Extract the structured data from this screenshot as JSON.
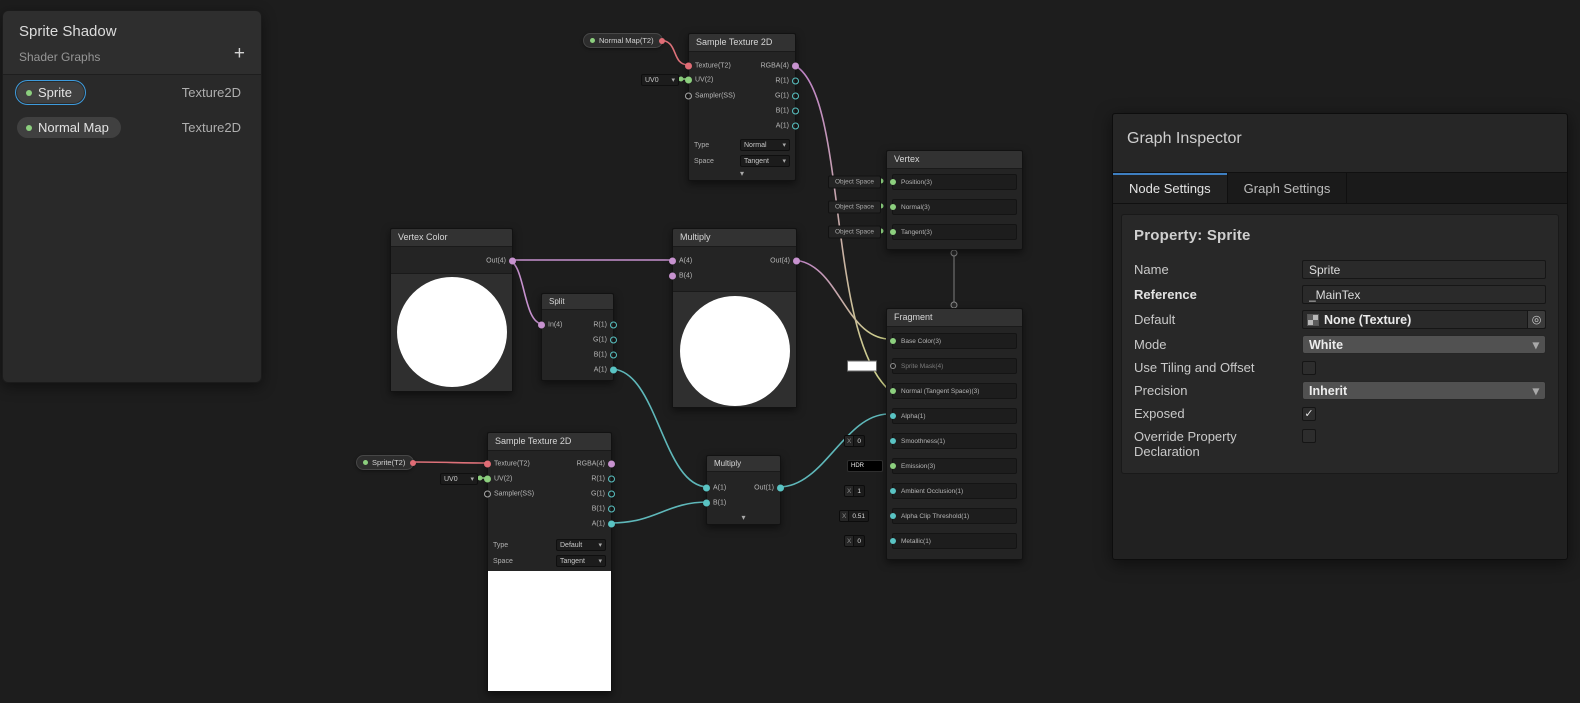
{
  "blackboard": {
    "title": "Sprite Shadow",
    "subtitle": "Shader Graphs",
    "add_label": "+",
    "items": [
      {
        "label": "Sprite",
        "type": "Texture2D"
      },
      {
        "label": "Normal Map",
        "type": "Texture2D"
      }
    ]
  },
  "pills": {
    "normal_map": "Normal Map(T2)",
    "sprite": "Sprite(T2)"
  },
  "nodes": {
    "sample_tex_top": {
      "title": "Sample Texture 2D",
      "inputs": [
        "Texture(T2)",
        "UV(2)",
        "Sampler(SS)"
      ],
      "uv_value": "UV0",
      "outputs": [
        "RGBA(4)",
        "R(1)",
        "G(1)",
        "B(1)",
        "A(1)"
      ],
      "type_label": "Type",
      "type_value": "Normal",
      "space_label": "Space",
      "space_value": "Tangent"
    },
    "sample_tex_bottom": {
      "title": "Sample Texture 2D",
      "inputs": [
        "Texture(T2)",
        "UV(2)",
        "Sampler(SS)"
      ],
      "uv_value": "UV0",
      "outputs": [
        "RGBA(4)",
        "R(1)",
        "G(1)",
        "B(1)",
        "A(1)"
      ],
      "type_label": "Type",
      "type_value": "Default",
      "space_label": "Space",
      "space_value": "Tangent"
    },
    "vertex_color": {
      "title": "Vertex Color",
      "output": "Out(4)"
    },
    "split": {
      "title": "Split",
      "input": "In(4)",
      "outputs": [
        "R(1)",
        "G(1)",
        "B(1)",
        "A(1)"
      ]
    },
    "multiply_top": {
      "title": "Multiply",
      "inputs": [
        "A(4)",
        "B(4)"
      ],
      "output": "Out(4)"
    },
    "multiply_bottom": {
      "title": "Multiply",
      "inputs": [
        "A(1)",
        "B(1)"
      ],
      "output": "Out(1)"
    },
    "vertex": {
      "title": "Vertex",
      "binding": "Object Space",
      "ports": [
        "Position(3)",
        "Normal(3)",
        "Tangent(3)"
      ]
    },
    "fragment": {
      "title": "Fragment",
      "ports": [
        {
          "label": "Base Color(3)"
        },
        {
          "label": "Sprite Mask(4)"
        },
        {
          "label": "Normal (Tangent Space)(3)"
        },
        {
          "label": "Alpha(1)"
        },
        {
          "label": "Smoothness(1)",
          "axis": "X",
          "value": "0"
        },
        {
          "label": "Emission(3)",
          "hdr": "HDR"
        },
        {
          "label": "Ambient Occlusion(1)",
          "axis": "X",
          "value": "1"
        },
        {
          "label": "Alpha Clip Threshold(1)",
          "axis": "X",
          "value": "0.51"
        },
        {
          "label": "Metallic(1)",
          "axis": "X",
          "value": "0"
        }
      ]
    }
  },
  "inspector": {
    "title": "Graph Inspector",
    "tabs": [
      {
        "label": "Node Settings"
      },
      {
        "label": "Graph Settings"
      }
    ],
    "property_header": "Property: Sprite",
    "fields": {
      "name_label": "Name",
      "name_value": "Sprite",
      "reference_label": "Reference",
      "reference_value": "_MainTex",
      "default_label": "Default",
      "default_value": "None (Texture)",
      "mode_label": "Mode",
      "mode_value": "White",
      "tiling_label": "Use Tiling and Offset",
      "precision_label": "Precision",
      "precision_value": "Inherit",
      "exposed_label": "Exposed",
      "override_label": "Override Property Declaration"
    }
  }
}
